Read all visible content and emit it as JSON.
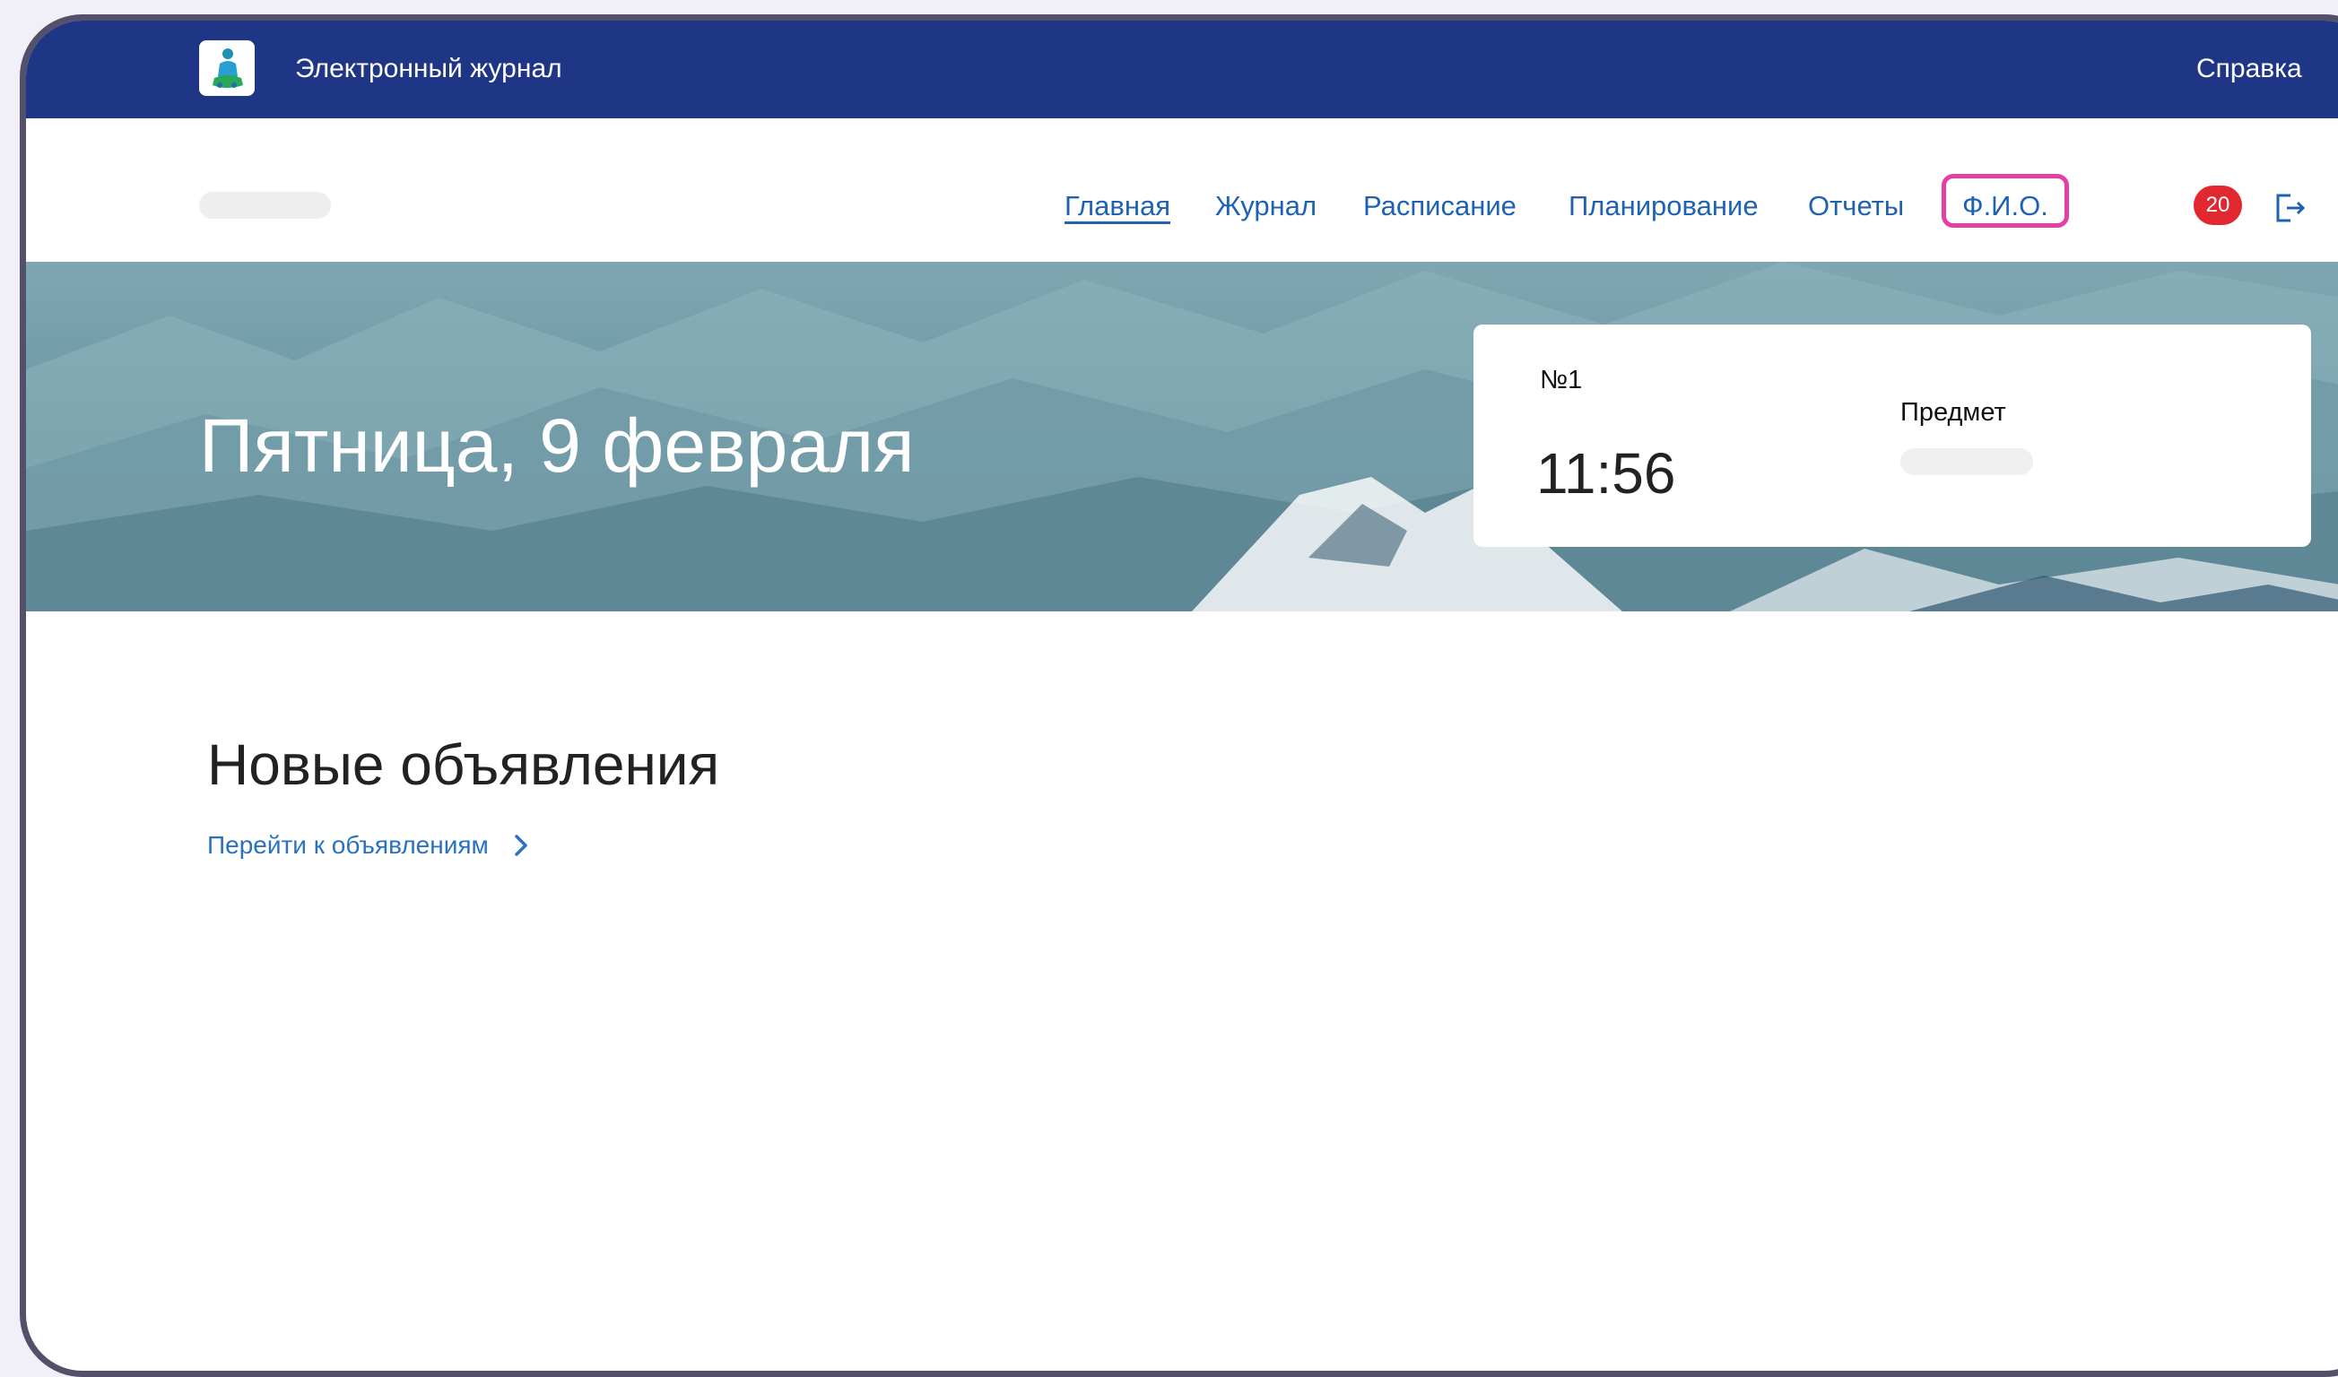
{
  "app": {
    "title": "Электронный журнал",
    "help_label": "Справка"
  },
  "nav": {
    "items": [
      {
        "label": "Главная",
        "active": true
      },
      {
        "label": "Журнал",
        "active": false
      },
      {
        "label": "Расписание",
        "active": false
      },
      {
        "label": "Планирование",
        "active": false
      },
      {
        "label": "Отчеты",
        "active": false
      },
      {
        "label": "Ф.И.О.",
        "active": false
      }
    ],
    "notifications_count": "20",
    "icons": {
      "logo": "school-logo-icon",
      "logout": "logout-icon"
    },
    "highlight_color": "#e33fa4"
  },
  "banner": {
    "date": "Пятница, 9 февраля",
    "lesson": {
      "number": "№1",
      "time": "11:56",
      "subject_label": "Предмет"
    }
  },
  "announcements": {
    "title": "Новые объявления",
    "link_label": "Перейти к объявлениям"
  },
  "colors": {
    "topbar": "#1f3687",
    "nav_link": "#1f62b3",
    "badge": "#e0282e"
  }
}
